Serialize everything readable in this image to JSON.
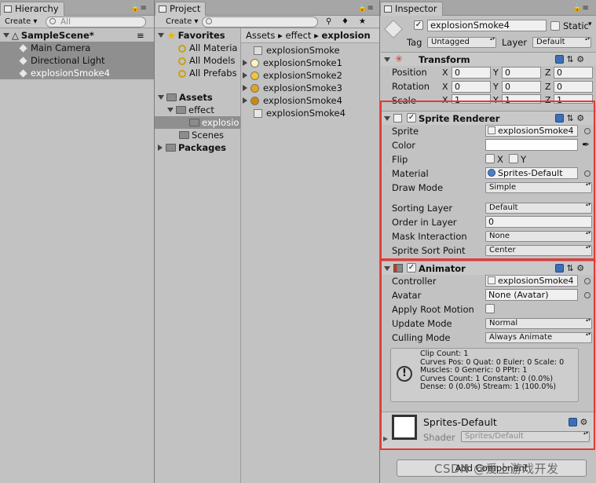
{
  "hierarchy": {
    "tab": "Hierarchy",
    "create": "Create",
    "search_placeholder": "All",
    "scene": "SampleScene*",
    "items": [
      "Main Camera",
      "Directional Light",
      "explosionSmoke4"
    ]
  },
  "project": {
    "tab": "Project",
    "create": "Create",
    "favorites": "Favorites",
    "favorite_items": [
      "All Materia",
      "All Models",
      "All Prefabs"
    ],
    "assets": "Assets",
    "effect": "effect",
    "explosion_folder": "explosio",
    "scenes": "Scenes",
    "packages": "Packages",
    "breadcrumb": [
      "Assets",
      "effect",
      "explosion"
    ],
    "files": [
      "explosionSmoke",
      "explosionSmoke1",
      "explosionSmoke2",
      "explosionSmoke3",
      "explosionSmoke4",
      "explosionSmoke4"
    ]
  },
  "inspector": {
    "tab": "Inspector",
    "object_name": "explosionSmoke4",
    "static_label": "Static",
    "tag_label": "Tag",
    "tag_value": "Untagged",
    "layer_label": "Layer",
    "layer_value": "Default",
    "transform": {
      "title": "Transform",
      "position_label": "Position",
      "rotation_label": "Rotation",
      "scale_label": "Scale",
      "axes": [
        "X",
        "Y",
        "Z"
      ],
      "position": [
        "0",
        "0",
        "0"
      ],
      "rotation": [
        "0",
        "0",
        "0"
      ],
      "scale": [
        "1",
        "1",
        "1"
      ]
    },
    "sprite_renderer": {
      "title": "Sprite Renderer",
      "sprite_label": "Sprite",
      "sprite_value": "explosionSmoke4",
      "color_label": "Color",
      "flip_label": "Flip",
      "flip_x": "X",
      "flip_y": "Y",
      "material_label": "Material",
      "material_value": "Sprites-Default",
      "draw_mode_label": "Draw Mode",
      "draw_mode_value": "Simple",
      "sorting_layer_label": "Sorting Layer",
      "sorting_layer_value": "Default",
      "order_label": "Order in Layer",
      "order_value": "0",
      "mask_label": "Mask Interaction",
      "mask_value": "None",
      "sort_point_label": "Sprite Sort Point",
      "sort_point_value": "Center"
    },
    "animator": {
      "title": "Animator",
      "controller_label": "Controller",
      "controller_value": "explosionSmoke4",
      "avatar_label": "Avatar",
      "avatar_value": "None (Avatar)",
      "root_motion_label": "Apply Root Motion",
      "update_mode_label": "Update Mode",
      "update_mode_value": "Normal",
      "culling_label": "Culling Mode",
      "culling_value": "Always Animate",
      "info": "Clip Count: 1\nCurves Pos: 0 Quat: 0 Euler: 0 Scale: 0\nMuscles: 0 Generic: 0 PPtr: 1\nCurves Count: 1 Constant: 0 (0.0%)\nDense: 0 (0.0%) Stream: 1 (100.0%)"
    },
    "material": {
      "name": "Sprites-Default",
      "shader_label": "Shader",
      "shader_value": "Sprites/Default"
    },
    "add_component": "Add Component"
  },
  "watermark": "CSDN @爱上游戏开发",
  "colors": {
    "highlight": "#e53935",
    "selection": "#8f8f8f"
  }
}
